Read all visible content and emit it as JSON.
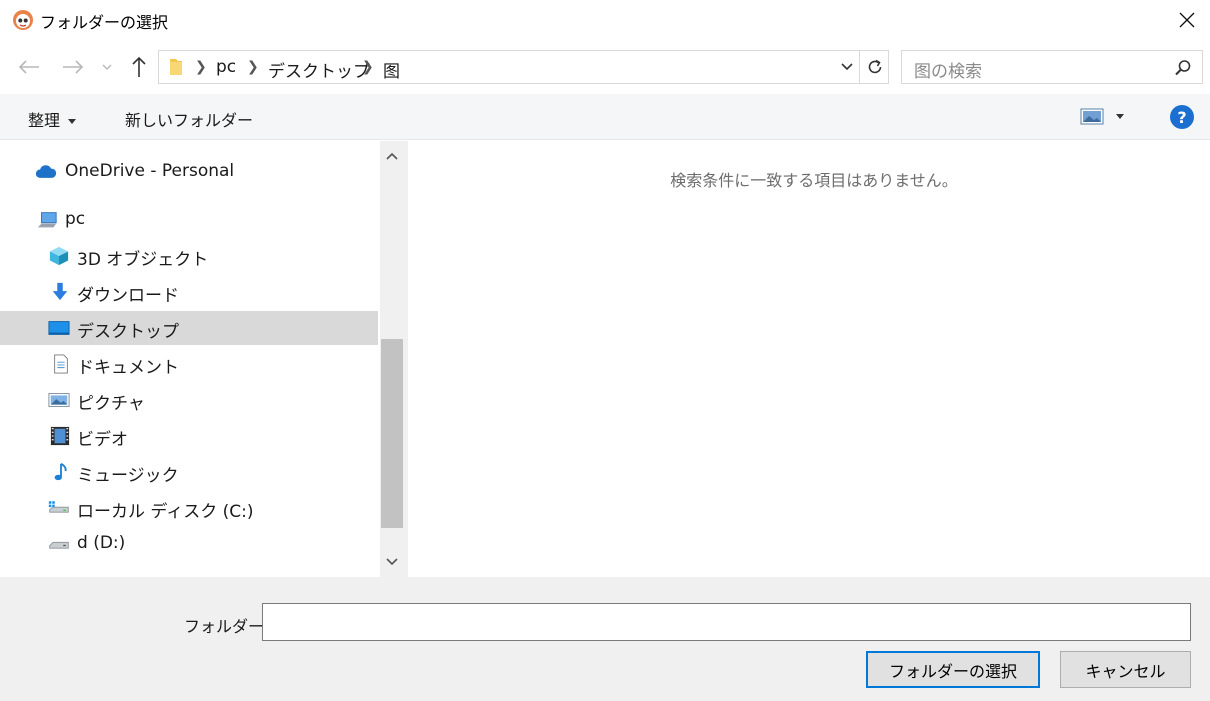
{
  "window": {
    "title": "フォルダーの選択"
  },
  "nav": {
    "back": "back-arrow",
    "forward": "forward-arrow",
    "up": "up-arrow"
  },
  "breadcrumb": [
    "pc",
    "デスクトップ",
    "图"
  ],
  "search": {
    "placeholder": "图の検索"
  },
  "toolbar": {
    "organize_label": "整理",
    "new_folder_label": "新しいフォルダー",
    "help_label": "?"
  },
  "sidebar": {
    "items": [
      {
        "label": "OneDrive - Personal",
        "icon": "cloud-icon"
      },
      {
        "label": "pc",
        "icon": "computer-icon"
      },
      {
        "label": "3D オブジェクト",
        "icon": "cube-icon"
      },
      {
        "label": "ダウンロード",
        "icon": "download-icon"
      },
      {
        "label": "デスクトップ",
        "icon": "desktop-icon",
        "selected": true
      },
      {
        "label": "ドキュメント",
        "icon": "document-icon"
      },
      {
        "label": "ピクチャ",
        "icon": "picture-icon"
      },
      {
        "label": "ビデオ",
        "icon": "video-icon"
      },
      {
        "label": "ミュージック",
        "icon": "music-icon"
      },
      {
        "label": "ローカル ディスク (C:)",
        "icon": "local-disk-icon"
      },
      {
        "label": "d (D:)",
        "icon": "drive-icon"
      }
    ]
  },
  "content": {
    "empty_message": "検索条件に一致する項目はありません。"
  },
  "footer": {
    "folder_label": "フォルダー:",
    "folder_value": "",
    "select_button": "フォルダーの選択",
    "cancel_button": "キャンセル"
  },
  "colors": {
    "accent": "#0078d7",
    "selected_bg": "#d9d9d9",
    "help_blue": "#1a6fd1"
  }
}
